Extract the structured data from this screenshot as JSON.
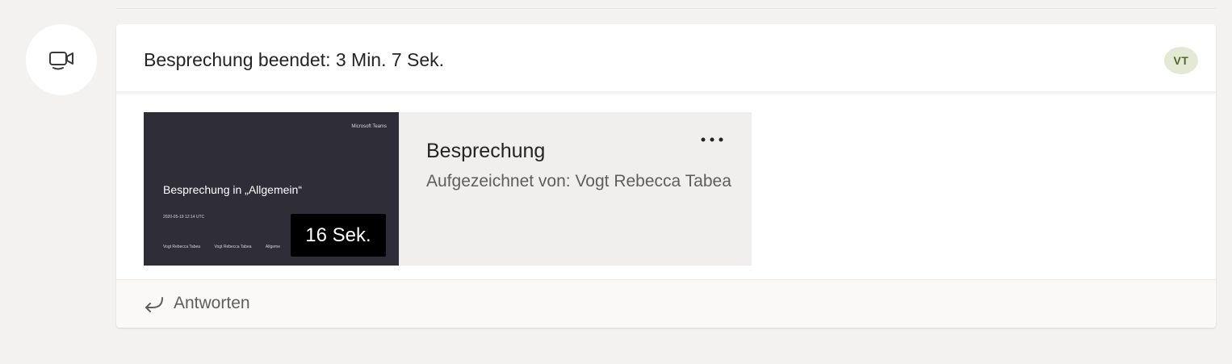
{
  "meeting_message": {
    "header_title": "Besprechung beendet: 3 Min. 7 Sek.",
    "user_initials": "VT",
    "recording": {
      "thumbnail": {
        "brand": "Microsoft Teams",
        "title": "Besprechung in „Allgemein“",
        "date": "2020-05-19 12:14 UTC",
        "meta_1": "Vogt Rebecca Tabea",
        "meta_2": "Vogt Rebecca Tabea",
        "meta_3": "Allgeme",
        "duration": "16 Sek."
      },
      "title": "Besprechung",
      "recorded_by": "Aufgezeichnet von: Vogt Rebecca Tabea"
    },
    "reply_label": "Antworten"
  },
  "colors": {
    "background": "#f3f2f1",
    "card": "#ffffff",
    "text_primary": "#252423",
    "text_secondary": "#605e5c",
    "thumbnail": "#2f2e38",
    "duration_badge": "#000000",
    "avatar_badge": "#e3e9d5"
  },
  "icons": {
    "meeting": "meeting-video-icon",
    "more": "more-options-icon",
    "reply": "reply-arrow-icon"
  }
}
